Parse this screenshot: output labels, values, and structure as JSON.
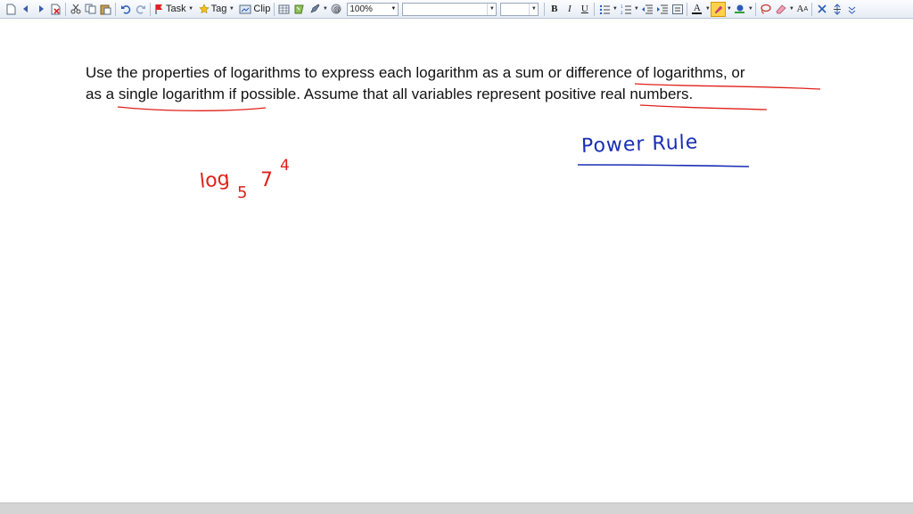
{
  "toolbar": {
    "task_label": "Task",
    "tag_label": "Tag",
    "clip_label": "Clip",
    "zoom_value": "100%",
    "font_name_value": "",
    "font_size_value": "",
    "bold": "B",
    "italic": "I",
    "underline": "U",
    "text_color_glyph": "A",
    "font_size_glyph": "A"
  },
  "document": {
    "line1": "Use the properties of logarithms to express each logarithm as a sum or difference of logarithms, or",
    "line2": "as a single logarithm if possible. Assume that all variables represent positive real numbers."
  },
  "handwriting": {
    "expression_log": "log",
    "expression_base": "5",
    "expression_arg": "7",
    "expression_exponent": "4",
    "rule_note": "Power Rule",
    "colors": {
      "red_ink": "#e0201a",
      "blue_ink": "#1a2fb5"
    }
  }
}
